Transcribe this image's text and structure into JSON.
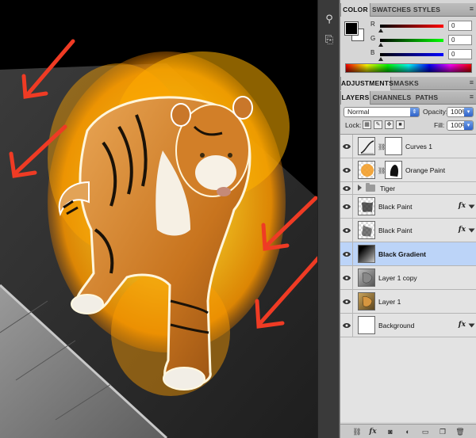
{
  "color_panel": {
    "tabs": [
      "COLOR",
      "SWATCHES",
      "STYLES"
    ],
    "active_tab": "COLOR",
    "foreground_color": "#000000",
    "background_color": "#ffffff",
    "channels": [
      {
        "label": "R",
        "value": "0"
      },
      {
        "label": "G",
        "value": "0"
      },
      {
        "label": "B",
        "value": "0"
      }
    ]
  },
  "adjustments_panel": {
    "tabs": [
      "ADJUSTMENTS",
      "MASKS"
    ]
  },
  "layers_panel": {
    "tabs": [
      "LAYERS",
      "CHANNELS",
      "PATHS"
    ],
    "active_tab": "LAYERS",
    "blend_mode": "Normal",
    "opacity_label": "Opacity:",
    "opacity_value": "100%",
    "lock_label": "Lock:",
    "fill_label": "Fill:",
    "fill_value": "100%",
    "layers": [
      {
        "name": "Curves 1",
        "kind": "adjustment",
        "fx": false,
        "selected": false
      },
      {
        "name": "Orange Paint",
        "kind": "masked",
        "fx": false,
        "selected": false
      },
      {
        "name": "Tiger",
        "kind": "group",
        "fx": false,
        "selected": false
      },
      {
        "name": "Black Paint",
        "kind": "paint",
        "fx": true,
        "selected": false
      },
      {
        "name": "Black Paint",
        "kind": "paint",
        "fx": true,
        "selected": false
      },
      {
        "name": "Black Gradient",
        "kind": "gradient",
        "fx": false,
        "selected": true
      },
      {
        "name": "Layer 1 copy",
        "kind": "pixel",
        "fx": false,
        "selected": false
      },
      {
        "name": "Layer 1",
        "kind": "pixel",
        "fx": false,
        "selected": false
      },
      {
        "name": "Background",
        "kind": "background",
        "fx": true,
        "selected": false
      }
    ]
  },
  "accent_colors": {
    "selection": "#bcd4f8",
    "arrow": "#ef3b24",
    "glow": "#ffb300"
  }
}
